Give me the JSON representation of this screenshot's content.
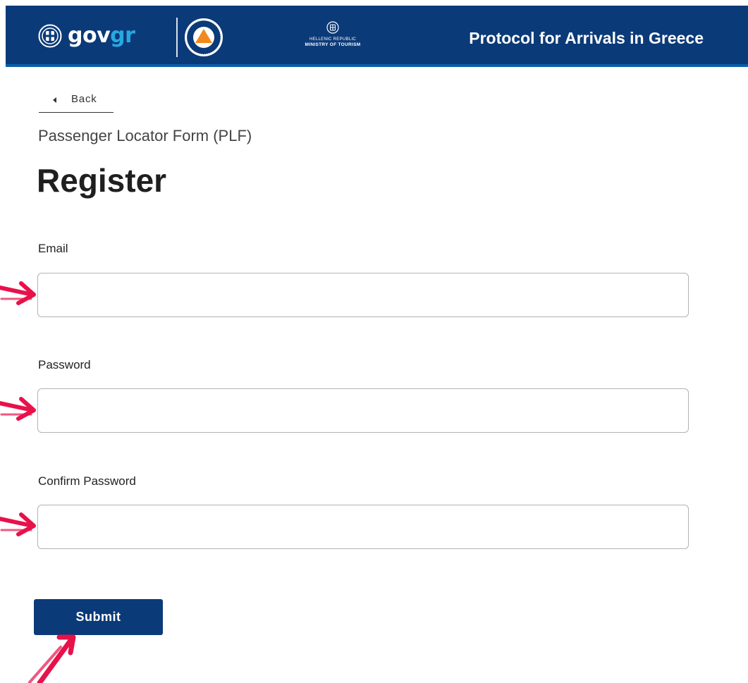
{
  "header": {
    "gov_brand": "gov",
    "gov_brand_accent": "gr",
    "ministry_line1": "HELLENIC REPUBLIC",
    "ministry_line2": "MINISTRY OF TOURISM",
    "title": "Protocol for Arrivals in Greece"
  },
  "nav": {
    "back_label": "Back"
  },
  "page": {
    "subtitle": "Passenger Locator Form (PLF)",
    "title": "Register"
  },
  "form": {
    "email_label": "Email",
    "email_value": "",
    "password_label": "Password",
    "password_value": "",
    "confirm_label": "Confirm Password",
    "confirm_value": "",
    "submit_label": "Submit"
  },
  "colors": {
    "header_bg": "#0b3a78",
    "header_accent_bar": "#0a5fa8",
    "brand_accent": "#29a8e0",
    "annotation_arrow": "#e8114a"
  },
  "icons": [
    "greek-emblem-icon",
    "civil-protection-logo",
    "ministry-emblem-icon",
    "back-triangle-icon",
    "annotation-arrow"
  ]
}
